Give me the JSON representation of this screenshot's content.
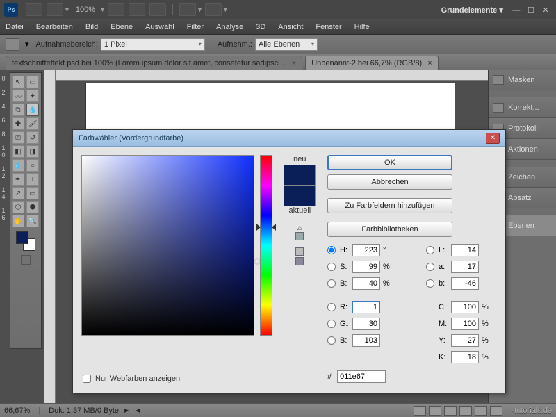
{
  "topbar": {
    "zoom": "100%",
    "ws_label": "Grundelemente ▾"
  },
  "menu": [
    "Datei",
    "Bearbeiten",
    "Bild",
    "Ebene",
    "Auswahl",
    "Filter",
    "Analyse",
    "3D",
    "Ansicht",
    "Fenster",
    "Hilfe"
  ],
  "options": {
    "label1": "Aufnahmebereich:",
    "dd1": "1 Pixel",
    "label2": "Aufnehm.:",
    "dd2": "Alle Ebenen"
  },
  "tabs": [
    {
      "label": "textschnitteffekt.psd bei 100% (Lorem ipsum dolor sit amet, consetetur sadipsci...",
      "active": false
    },
    {
      "label": "Unbenannt-2 bei 66,7% (RGB/8)",
      "active": true
    }
  ],
  "panels": [
    "Masken",
    "Korrekt...",
    "Protokoll",
    "Aktionen",
    "Zeichen",
    "Absatz",
    "Ebenen"
  ],
  "status": {
    "zoom": "66,67%",
    "doc": "Dok: 1,37 MB/0 Byte",
    "watermark": "-tutorials.de"
  },
  "dialog": {
    "title": "Farbwähler (Vordergrundfarbe)",
    "ok": "OK",
    "cancel": "Abbrechen",
    "add_swatch": "Zu Farbfeldern hinzufügen",
    "libs": "Farbbibliotheken",
    "neu": "neu",
    "aktuell": "aktuell",
    "webonly": "Nur Webfarben anzeigen",
    "H": "223",
    "S": "99",
    "Bh": "40",
    "L": "14",
    "a": "17",
    "b": "-46",
    "R": "1",
    "G": "30",
    "Bv": "103",
    "C": "100",
    "M": "100",
    "Y": "27",
    "K": "18",
    "hex": "011e67",
    "labels": {
      "H": "H:",
      "S": "S:",
      "B": "B:",
      "L": "L:",
      "a": "a:",
      "b": "b:",
      "R": "R:",
      "G": "G:",
      "Bv": "B:",
      "C": "C:",
      "M": "M:",
      "Y": "Y:",
      "K": "K:",
      "deg": "°",
      "pct": "%",
      "hash": "#"
    }
  }
}
